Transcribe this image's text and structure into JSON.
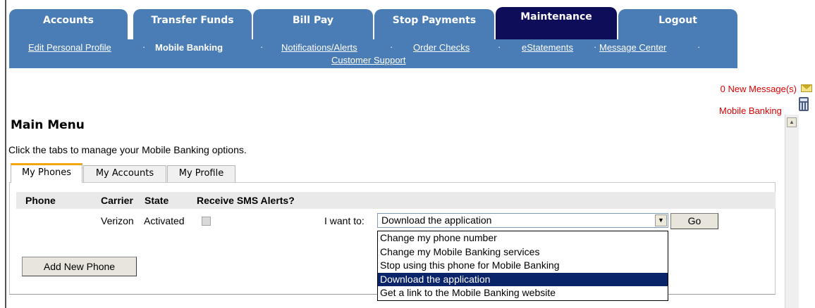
{
  "nav": {
    "tabs": [
      {
        "label": "Accounts"
      },
      {
        "label": "Transfer Funds"
      },
      {
        "label": "Bill Pay"
      },
      {
        "label": "Stop Payments"
      },
      {
        "label": "Maintenance"
      },
      {
        "label": "Logout"
      }
    ],
    "active_tab": "Maintenance",
    "sub_links": [
      {
        "label": "Edit Personal Profile"
      },
      {
        "label": "Mobile Banking"
      },
      {
        "label": "Notifications/Alerts"
      },
      {
        "label": "Order Checks"
      },
      {
        "label": "eStatements"
      },
      {
        "label": "Message Center"
      },
      {
        "label": "Customer Support"
      }
    ],
    "separator": "·"
  },
  "status": {
    "messages": "0 New Message(s)",
    "mobile_banking": "Mobile Banking"
  },
  "page": {
    "title": "Main Menu",
    "instruction": "Click the tabs to manage your Mobile Banking options."
  },
  "subtabs": [
    {
      "label": "My Phones"
    },
    {
      "label": "My Accounts"
    },
    {
      "label": "My Profile"
    }
  ],
  "table": {
    "headers": [
      "Phone",
      "Carrier",
      "State",
      "Receive SMS Alerts?"
    ],
    "row": {
      "phone": "",
      "carrier": "Verizon",
      "state": "Activated",
      "sms_alerts": false
    }
  },
  "action": {
    "label": "I want to:",
    "selected": "Download the application",
    "options": [
      "Change my phone number",
      "Change my Mobile Banking services",
      "Stop using this phone for Mobile Banking",
      "Download the application",
      "Get a link to the Mobile Banking website"
    ],
    "go_label": "Go"
  },
  "add_phone_label": "Add New Phone",
  "colors": {
    "nav_blue": "#4a7cb5",
    "nav_active": "#0d0d5a",
    "alert_red": "#e00000",
    "selection": "#0a246a",
    "active_tab_accent": "#f2a60a"
  },
  "icons": {
    "messages": "envelope-icon",
    "mobile_banking": "calculator-icon",
    "select_arrow": "chevron-down-icon",
    "scroll_up": "arrow-up-icon"
  }
}
